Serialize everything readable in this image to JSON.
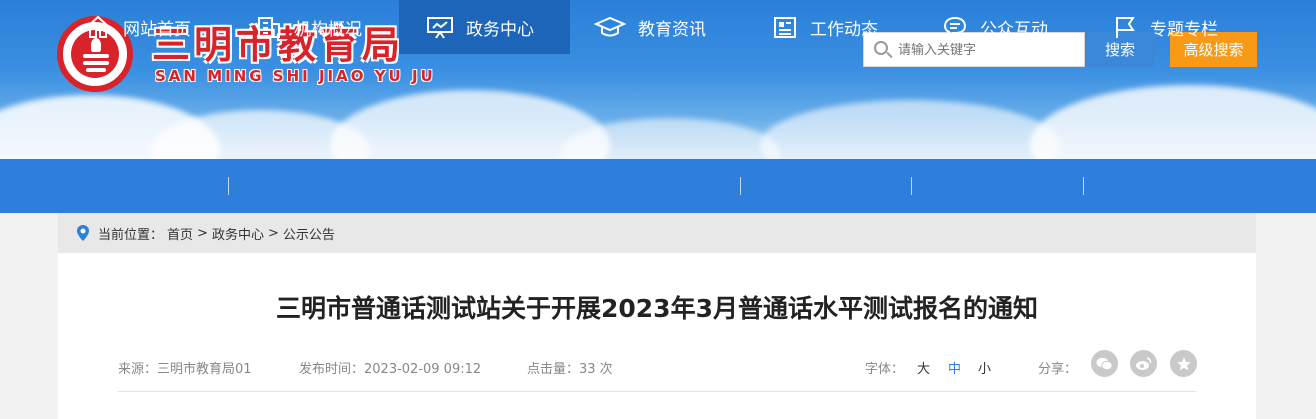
{
  "header": {
    "site_title": "三明市教育局",
    "site_pinyin": "SAN MING SHI JIAO YU JU",
    "search_placeholder": "请输入关键字",
    "search_button": "搜索",
    "advanced_search_button": "高级搜索"
  },
  "nav": {
    "items": [
      {
        "label": "网站首页",
        "icon": "home-icon"
      },
      {
        "label": "机构概况",
        "icon": "building-icon"
      },
      {
        "label": "政务中心",
        "icon": "presentation-icon",
        "active": true
      },
      {
        "label": "教育资讯",
        "icon": "graduation-cap-icon"
      },
      {
        "label": "工作动态",
        "icon": "news-icon"
      },
      {
        "label": "公众互动",
        "icon": "chat-icon"
      },
      {
        "label": "专题专栏",
        "icon": "flag-icon"
      }
    ]
  },
  "breadcrumb": {
    "prefix": "当前位置：",
    "items": [
      "首页",
      "政务中心",
      "公示公告"
    ],
    "separator": ">"
  },
  "article": {
    "title": "三明市普通话测试站关于开展2023年3月普通话水平测试报名的通知",
    "source": "来源：三明市教育局01",
    "published": "发布时间：2023-02-09 09:12",
    "views": "点击量：33 次",
    "font_label": "字体：",
    "font_options": [
      "大",
      "中",
      "小"
    ],
    "font_selected": "中",
    "share_label": "分享："
  },
  "colors": {
    "brand_red": "#d9232a",
    "nav_blue": "#2e7fdb",
    "nav_active": "#1d65b8",
    "search_blue": "#3b88d8",
    "advanced_orange": "#f99a17"
  }
}
